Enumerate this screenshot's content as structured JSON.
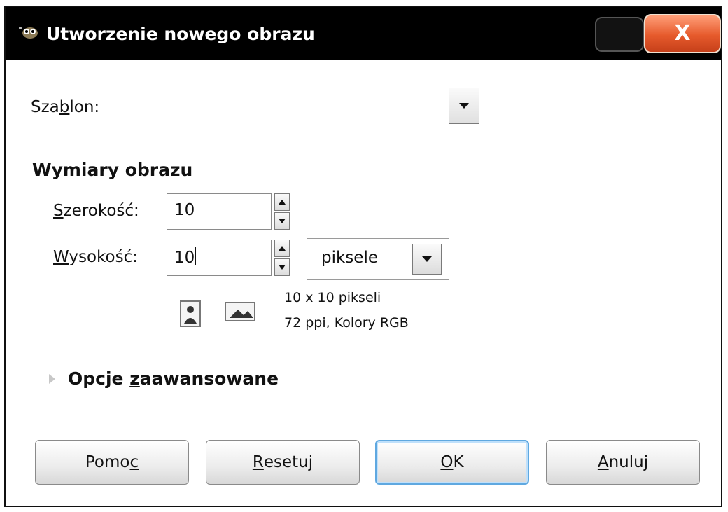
{
  "window": {
    "title": "Utworzenie nowego obrazu",
    "close_glyph": "X",
    "app_icon": "gimp-wilber-icon"
  },
  "template": {
    "label_before": "Sza",
    "label_underlined": "b",
    "label_after": "lon:",
    "value": ""
  },
  "dimensions": {
    "heading": "Wymiary obrazu",
    "width": {
      "label_underlined": "S",
      "label_rest": "zerokość:",
      "value": "10"
    },
    "height": {
      "label_underlined": "W",
      "label_rest": "ysokość:",
      "value": "10"
    },
    "unit": "piksele",
    "info_line1": "10 x 10 pikseli",
    "info_line2": "72 ppi, Kolory RGB",
    "orientation_icons": [
      "portrait-icon",
      "landscape-icon"
    ]
  },
  "advanced": {
    "label_before": "Opcje ",
    "label_underlined": "z",
    "label_after": "aawansowane"
  },
  "buttons": {
    "help": {
      "before": "Pomo",
      "underlined": "c",
      "after": ""
    },
    "reset": {
      "before": "",
      "underlined": "R",
      "after": "esetuj"
    },
    "ok": {
      "before": "",
      "underlined": "O",
      "after": "K"
    },
    "cancel": {
      "before": "",
      "underlined": "A",
      "after": "nuluj"
    }
  },
  "colors": {
    "titlebar": "#000000",
    "close_button": "#e65a2c",
    "ok_focus": "#5fa8e0"
  }
}
